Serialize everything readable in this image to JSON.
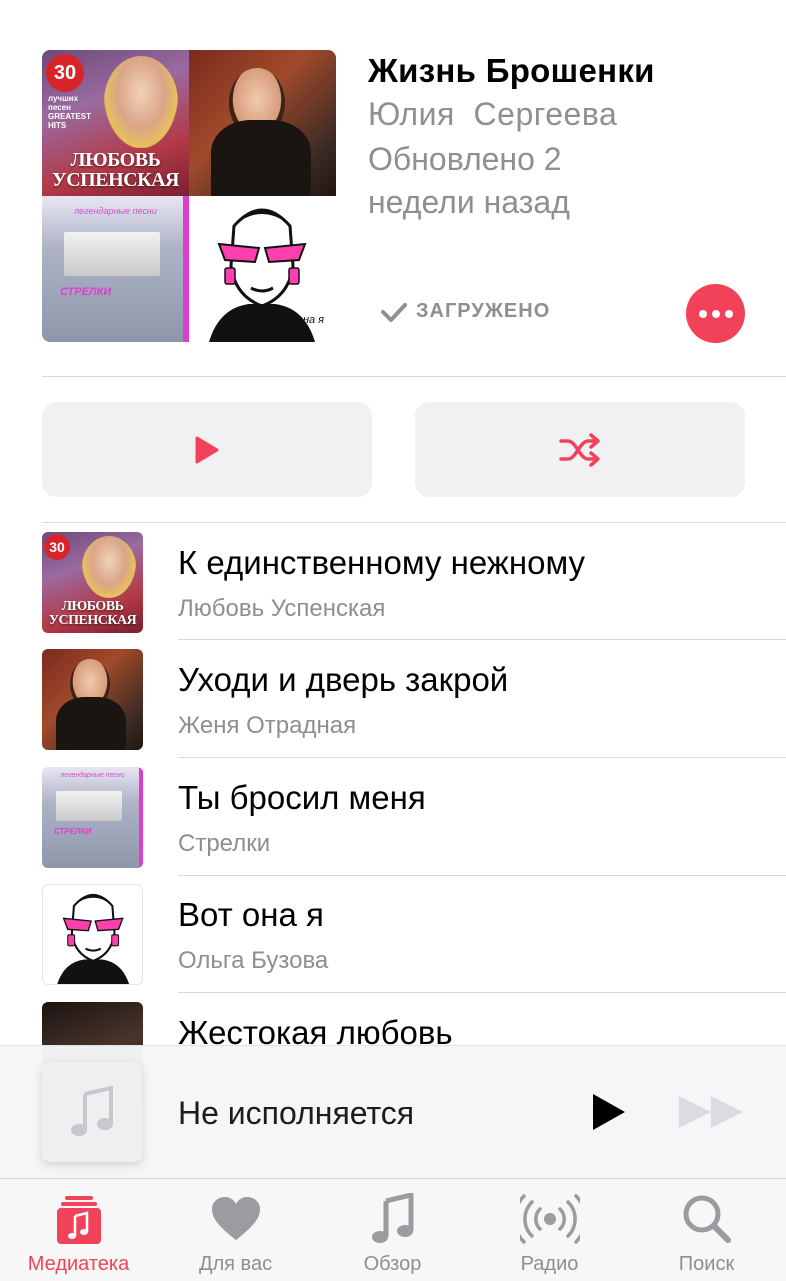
{
  "playlist": {
    "title": "Жизнь Брошенки",
    "author": "Юлия  Сергеева",
    "updated": "Обновлено 2 недели назад",
    "status": "ЗАГРУЖЕНО"
  },
  "artwork_text": {
    "uspenskaya": {
      "count": "30",
      "line1": "лучших",
      "line2": "песен",
      "line3": "GREATEST",
      "line4": "HITS",
      "name1": "ЛЮБОВЬ",
      "name2": "УСПЕНСКАЯ"
    },
    "strelki": {
      "header": "легендарные песни",
      "band": "СТРЕЛКИ"
    },
    "buzova": {
      "caption": "вот она я"
    }
  },
  "songs": [
    {
      "title": "К единственному нежному",
      "artist": "Любовь Успенская",
      "art": "uspenskaya"
    },
    {
      "title": "Уходи и дверь закрой",
      "artist": "Женя Отрадная",
      "art": "otradnaya"
    },
    {
      "title": "Ты бросил меня",
      "artist": "Стрелки",
      "art": "strelki"
    },
    {
      "title": "Вот она я",
      "artist": "Ольга Бузова",
      "art": "buzova"
    },
    {
      "title": "Жестокая любовь",
      "artist": "",
      "art": "kirkorov"
    }
  ],
  "player": {
    "status": "Не исполняется"
  },
  "tabs": [
    {
      "label": "Медиатека",
      "icon": "library-icon",
      "active": true
    },
    {
      "label": "Для вас",
      "icon": "heart-icon",
      "active": false
    },
    {
      "label": "Обзор",
      "icon": "music-note-icon",
      "active": false
    },
    {
      "label": "Радио",
      "icon": "radio-icon",
      "active": false
    },
    {
      "label": "Поиск",
      "icon": "search-icon",
      "active": false
    }
  ],
  "colors": {
    "accent": "#f2425a",
    "secondary_text": "#8e8e93",
    "button_bg": "#f1f1f4"
  }
}
